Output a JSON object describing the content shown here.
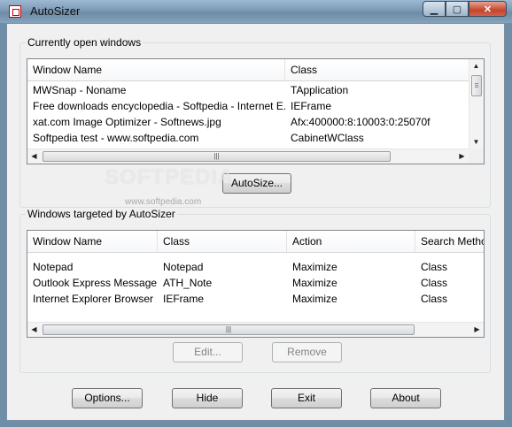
{
  "window": {
    "title": "AutoSizer",
    "minimize_icon": "minimize-icon",
    "maximize_icon": "maximize-icon",
    "close_icon": "close-icon"
  },
  "open_windows": {
    "label": "Currently open windows",
    "columns": [
      "Window Name",
      "Class"
    ],
    "rows": [
      [
        "MWSnap - Noname",
        "TApplication"
      ],
      [
        "Free downloads encyclopedia - Softpedia - Internet E...",
        "IEFrame"
      ],
      [
        "xat.com  Image Optimizer - Softnews.jpg",
        "Afx:400000:8:10003:0:25070f"
      ],
      [
        "Softpedia test - www.softpedia.com",
        "CabinetWClass"
      ]
    ],
    "autosize_button": "AutoSize..."
  },
  "targeted": {
    "label": "Windows targeted by AutoSizer",
    "columns": [
      "Window Name",
      "Class",
      "Action",
      "Search Metho"
    ],
    "rows": [
      [
        "Notepad",
        "Notepad",
        "Maximize",
        "Class"
      ],
      [
        "Outlook Express Message",
        "ATH_Note",
        "Maximize",
        "Class"
      ],
      [
        "Internet Explorer Browser",
        "IEFrame",
        "Maximize",
        "Class"
      ]
    ],
    "edit_button": "Edit...",
    "remove_button": "Remove"
  },
  "footer": {
    "options": "Options...",
    "hide": "Hide",
    "exit": "Exit",
    "about": "About"
  },
  "watermark": {
    "text": "SOFTPEDIA",
    "sub": "www.softpedia.com"
  }
}
